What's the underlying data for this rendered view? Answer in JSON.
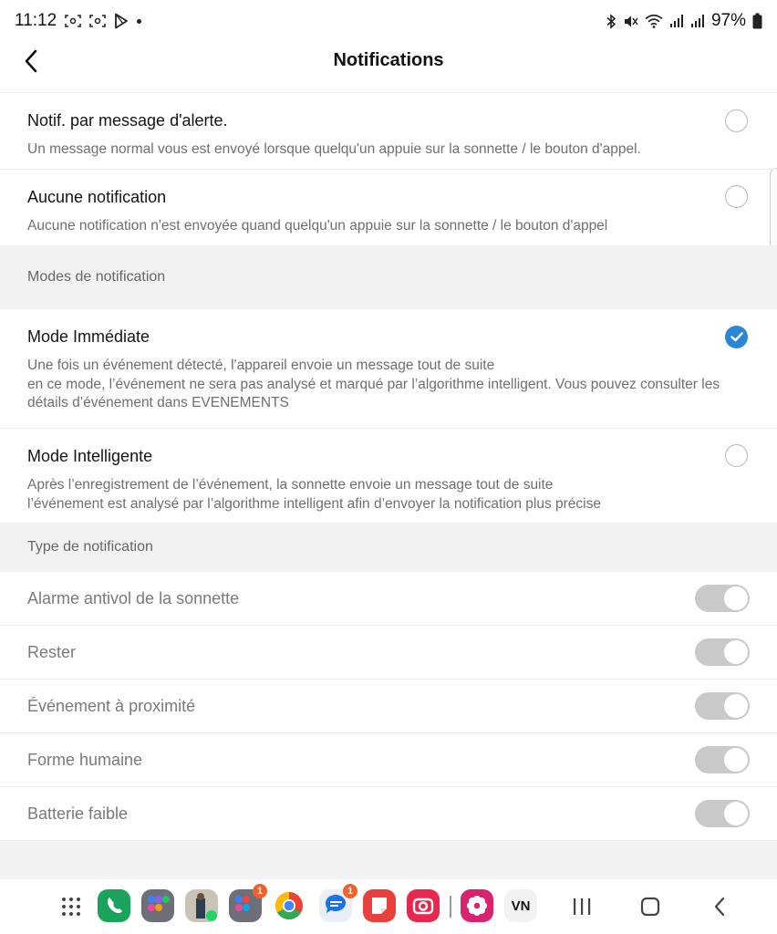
{
  "status_bar": {
    "time": "11:12",
    "battery": "97%"
  },
  "header": {
    "title": "Notifications"
  },
  "alert_options": [
    {
      "title": "Notif. par message d'alerte.",
      "description": "Un message normal vous est envoyé lorsque quelqu'un appuie sur la sonnette / le bouton d'appel.",
      "selected": false
    },
    {
      "title": "Aucune notification",
      "description": "Aucune notification n'est envoyée quand quelqu'un appuie sur la sonnette / le bouton d'appel",
      "selected": false
    }
  ],
  "modes_section": {
    "header": "Modes de notification",
    "items": [
      {
        "title": "Mode Immédiate",
        "description": "Une fois un événement détecté, l'appareil envoie un message tout de suite\n en ce mode, l’événement ne sera pas analysé et marqué par l’algorithme intelligent. Vous pouvez consulter les détails d’événement dans EVENEMENTS",
        "selected": true
      },
      {
        "title": "Mode Intelligente",
        "description": "Après l’enregistrement de l’événement, la sonnette envoie un message tout de suite\n l’événement est analysé par l’algorithme intelligent afin d’envoyer la notification plus précise",
        "selected": false
      }
    ]
  },
  "type_section": {
    "header": "Type de notification",
    "items": [
      {
        "label": "Alarme antivol de la sonnette",
        "enabled": true
      },
      {
        "label": "Rester",
        "enabled": true
      },
      {
        "label": "Événement à proximité",
        "enabled": true
      },
      {
        "label": "Forme humaine",
        "enabled": true
      },
      {
        "label": "Batterie faible",
        "enabled": true
      }
    ]
  },
  "dock": {
    "apps": [
      {
        "icon": "phone-app-icon",
        "color": "#1aa35a",
        "badge": ""
      },
      {
        "icon": "app-folder-icon",
        "color": "#6d6f78",
        "badge": ""
      },
      {
        "icon": "whatsapp-contact-icon",
        "color": "#c9c3b5",
        "badge": ""
      },
      {
        "icon": "app-folder-icon",
        "color": "#6d6f78",
        "badge": "1"
      },
      {
        "icon": "chrome-icon",
        "color": "#ffffff",
        "badge": ""
      },
      {
        "icon": "messages-icon",
        "color": "#e9eef8",
        "badge": "1"
      },
      {
        "icon": "notes-app-icon",
        "color": "#e8403c",
        "badge": ""
      },
      {
        "icon": "camera-app-icon",
        "color": "#e8274f",
        "badge": ""
      },
      {
        "icon": "flower-app-icon",
        "color": "#d8246e",
        "badge": ""
      },
      {
        "icon": "vn-app-icon",
        "color": "#f2f2f2",
        "badge": "",
        "label": "VN"
      }
    ]
  },
  "colors": {
    "accent": "#2b86d8",
    "toggle_off": "#c9c9c9",
    "section_bg": "#f2f2f2"
  }
}
